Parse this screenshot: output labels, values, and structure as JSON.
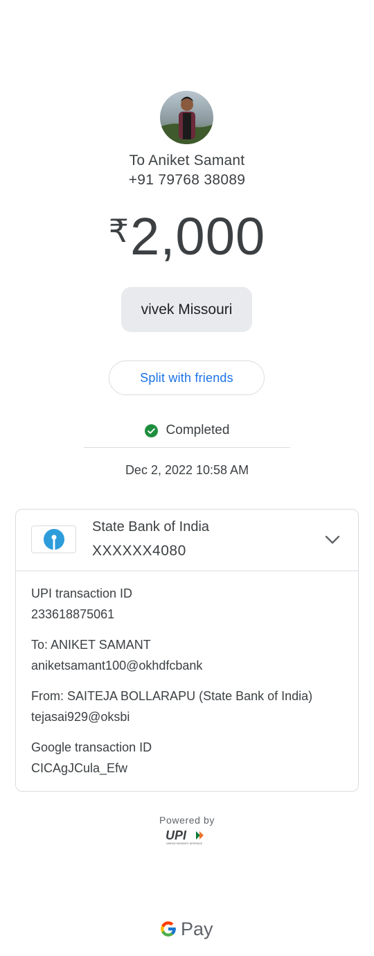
{
  "payee": {
    "name_line": "To Aniket Samant",
    "phone": "+91 79768 38089"
  },
  "amount": {
    "currency_symbol": "₹",
    "value": "2,000"
  },
  "note": "vivek Missouri",
  "split_button_label": "Split with friends",
  "status": {
    "text": "Completed",
    "color": "#1e8e3e"
  },
  "date_time": "Dec 2, 2022 10:58 AM",
  "bank": {
    "name": "State Bank of India",
    "account": "XXXXXX4080",
    "logo_color": "#2d9cdb"
  },
  "details": [
    {
      "label": "UPI transaction ID",
      "value": "233618875061"
    },
    {
      "label": "To: ANIKET SAMANT",
      "value": "aniketsamant100@okhdfcbank"
    },
    {
      "label": "From: SAITEJA  BOLLARAPU (State Bank of India)",
      "value": "tejasai929@oksbi"
    },
    {
      "label": "Google transaction ID",
      "value": "CICAgJCula_Efw"
    }
  ],
  "footer": {
    "powered_by": "Powered by",
    "upi_logo": "UPI",
    "upi_tagline": "UNIFIED PAYMENTS INTERFACE",
    "brand": "Pay"
  },
  "colors": {
    "accent": "#1a73e8",
    "text": "#3c4043",
    "chip_bg": "#e8eaed"
  }
}
